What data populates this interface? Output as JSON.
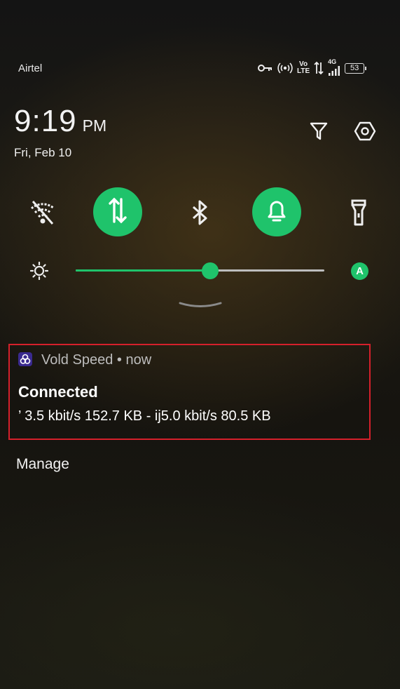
{
  "status_bar": {
    "carrier": "Airtel",
    "volte_top": "Vo",
    "volte_bottom": "LTE",
    "network_type": "4G",
    "battery": "53",
    "icons": [
      "key-icon",
      "hotspot-icon",
      "volte-icon",
      "data-activity-icon",
      "signal-icon",
      "battery-icon"
    ]
  },
  "clock": {
    "time": "9:19",
    "ampm": "PM",
    "date": "Fri, Feb 10"
  },
  "header_actions": [
    {
      "name": "notification-filter",
      "icon": "filter-icon"
    },
    {
      "name": "settings",
      "icon": "settings-icon"
    }
  ],
  "quick_tiles": [
    {
      "name": "wifi",
      "icon": "wifi-off-icon",
      "active": false
    },
    {
      "name": "mobile-data",
      "icon": "mobile-data-icon",
      "active": true
    },
    {
      "name": "bluetooth",
      "icon": "bluetooth-icon",
      "active": false
    },
    {
      "name": "sound",
      "icon": "bell-icon",
      "active": true
    },
    {
      "name": "flashlight",
      "icon": "flashlight-icon",
      "active": false
    }
  ],
  "brightness": {
    "level": 0.54,
    "auto_label": "A",
    "icon": "brightness-icon"
  },
  "notification": {
    "app_name": "Vold Speed",
    "separator": "•",
    "time": "now",
    "title": "Connected",
    "body": "’ 3.5 kbit/s 152.7 KB - ij5.0 kbit/s 80.5 KB"
  },
  "manage_label": "Manage",
  "colors": {
    "accent": "#1fc36b",
    "highlight_border": "#d5202b",
    "app_icon_bg": "#3a2a8f"
  }
}
